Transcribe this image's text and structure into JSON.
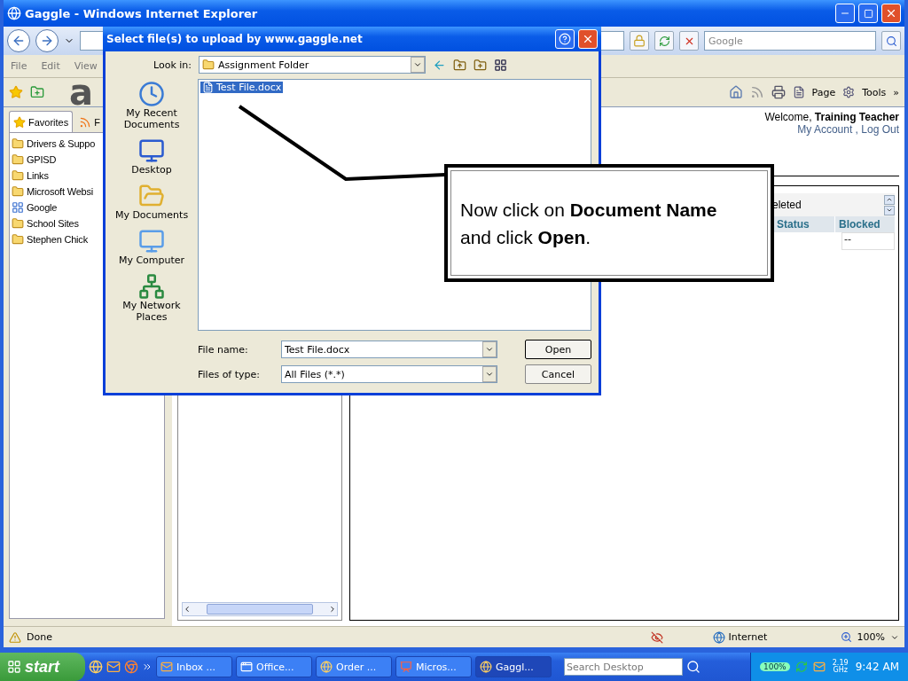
{
  "window": {
    "title": "Gaggle - Windows Internet Explorer"
  },
  "search": {
    "placeholder": "Google"
  },
  "menu": [
    "File",
    "Edit",
    "View"
  ],
  "overlay_letter": "a",
  "command_bar": {
    "page": "Page",
    "tools": "Tools",
    "more": "»"
  },
  "favorites_pane": {
    "tabs": [
      {
        "label": "Favorites",
        "selected": true
      },
      {
        "label": "F",
        "selected": false
      }
    ],
    "items": [
      {
        "label": "Drivers & Suppo",
        "kind": "folder"
      },
      {
        "label": "GPISD",
        "kind": "folder"
      },
      {
        "label": "Links",
        "kind": "folder"
      },
      {
        "label": "Microsoft Websi",
        "kind": "folder"
      },
      {
        "label": "Google",
        "kind": "site"
      },
      {
        "label": "School Sites",
        "kind": "folder"
      },
      {
        "label": "Stephen Chick",
        "kind": "folder"
      }
    ]
  },
  "page": {
    "welcome": "Welcome, **Training Teacher**",
    "account_links": [
      "My Account",
      "Log Out"
    ],
    "link_separator": ",",
    "panel_title": "eleted",
    "columns": [
      "Status",
      "Blocked"
    ],
    "cell": "--"
  },
  "dialog": {
    "title": "Select file(s) to upload by www.gaggle.net",
    "look_in_label": "Look in:",
    "look_in": "Assignment Folder",
    "places": [
      {
        "label": "My Recent Documents",
        "kind": "recent"
      },
      {
        "label": "Desktop",
        "kind": "desktop"
      },
      {
        "label": "My Documents",
        "kind": "documents"
      },
      {
        "label": "My Computer",
        "kind": "computer"
      },
      {
        "label": "My Network Places",
        "kind": "network"
      }
    ],
    "files": [
      {
        "name": "Test File.docx",
        "selected": true
      }
    ],
    "file_name_label": "File name:",
    "file_name": "Test File.docx",
    "file_type_label": "Files of type:",
    "file_type": "All Files (*.*)",
    "buttons": [
      "Open",
      "Cancel"
    ]
  },
  "callout": {
    "text": "Now click on **Document Name** and click **Open**."
  },
  "status_bar": {
    "text": "Done",
    "zone": "Internet",
    "zoom": "100%"
  },
  "taskbar": {
    "start": "start",
    "tasks": [
      {
        "label": "Inbox ...",
        "kind": "mail",
        "selected": false
      },
      {
        "label": "Office...",
        "kind": "app",
        "selected": false
      },
      {
        "label": "Order ...",
        "kind": "browser",
        "selected": false
      },
      {
        "label": "Micros...",
        "kind": "office",
        "selected": false
      },
      {
        "label": "Gaggl...",
        "kind": "browser",
        "selected": true
      }
    ],
    "search_placeholder": "Search Desktop",
    "battery": "100%",
    "cpu": "2.19 GHz",
    "clock": "9:42 AM"
  }
}
